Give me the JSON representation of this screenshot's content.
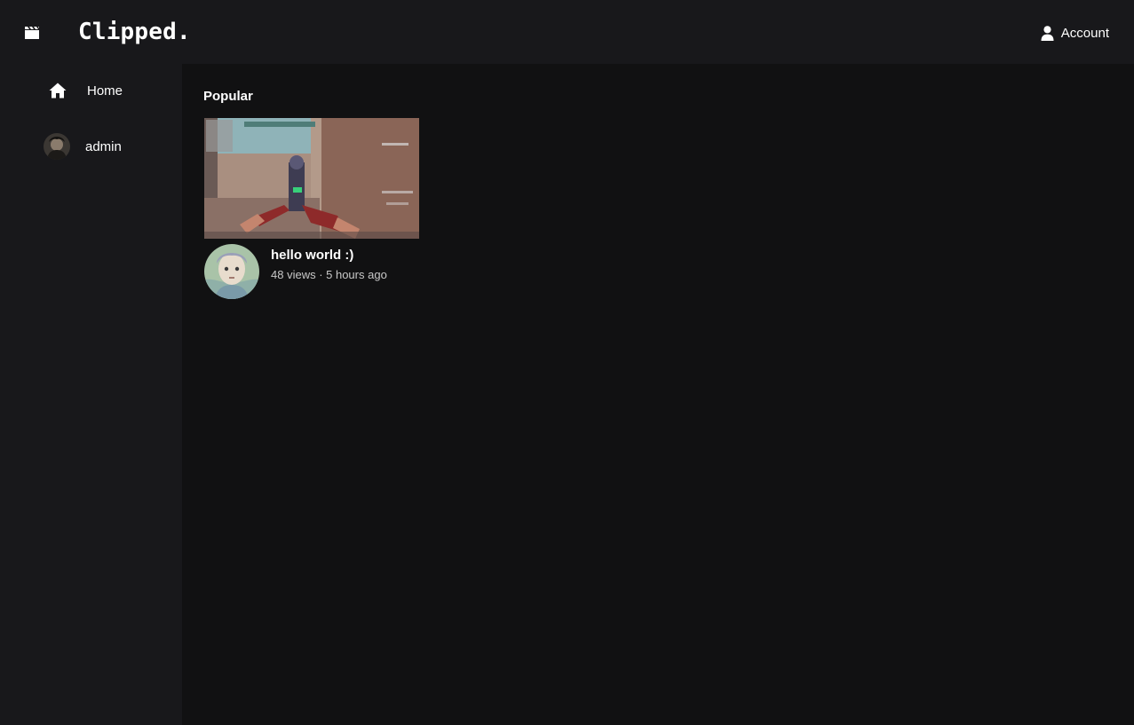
{
  "header": {
    "logo_icon": "clapperboard-icon",
    "title": "Clipped.",
    "account_icon": "user-icon",
    "account_label": "Account"
  },
  "sidebar": {
    "items": [
      {
        "icon": "home-icon",
        "label": "Home"
      },
      {
        "icon": "avatar",
        "label": "admin"
      }
    ]
  },
  "main": {
    "section_title": "Popular",
    "videos": [
      {
        "title": "hello world :)",
        "meta": "48 views · 5 hours ago"
      }
    ]
  },
  "colors": {
    "background": "#111112",
    "panel": "#18181b",
    "text": "#ffffff",
    "muted_text": "#c8c8c8"
  }
}
